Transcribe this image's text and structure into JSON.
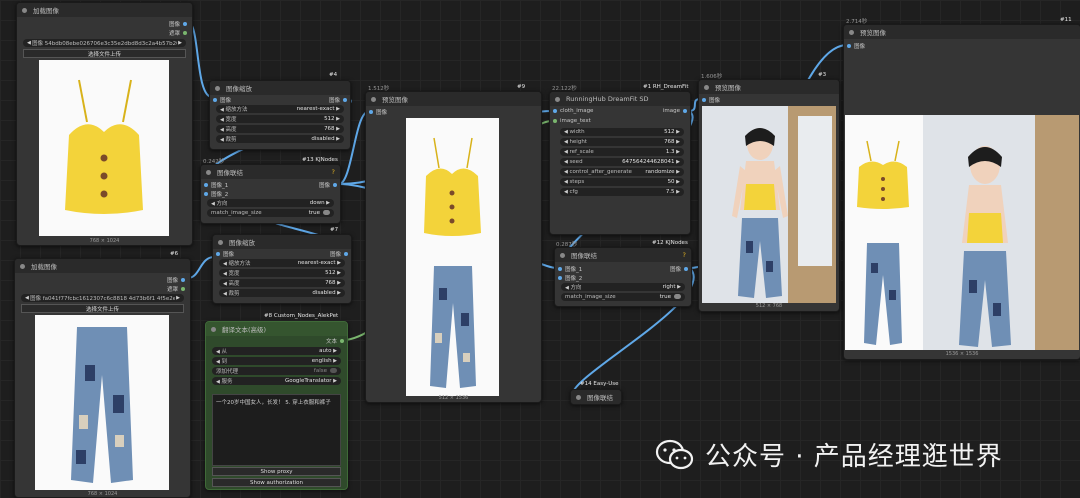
{
  "nodes": {
    "load1": {
      "title": "加载图像",
      "out_image": "图像",
      "out_mask": "遮罩",
      "file": "图像  54bdb08ebe026706e3c35e2dbd8d3c2a4b57b203...",
      "upload": "选择文件上传",
      "caption": "768 × 1024"
    },
    "load2": {
      "badge": "#6",
      "title": "加载图像",
      "out_image": "图像",
      "out_mask": "遮罩",
      "file": "图像  fa041f77fcbc1612307c6c8818 4d73b6f1 4f5e2ee881...",
      "upload": "选择文件上传",
      "caption": "768 × 1024"
    },
    "scale1": {
      "badge": "#4",
      "title": "图像缩放",
      "in_image": "图像",
      "out_image": "图像",
      "rows": [
        {
          "k": "缩放方法",
          "v": "nearest-exact"
        },
        {
          "k": "宽度",
          "v": "512"
        },
        {
          "k": "高度",
          "v": "768"
        },
        {
          "k": "裁剪",
          "v": "disabled"
        }
      ]
    },
    "scale2": {
      "badge": "#7",
      "title": "图像缩放",
      "in_image": "图像",
      "out_image": "图像",
      "rows": [
        {
          "k": "缩放方法",
          "v": "nearest-exact"
        },
        {
          "k": "宽度",
          "v": "512"
        },
        {
          "k": "高度",
          "v": "768"
        },
        {
          "k": "裁剪",
          "v": "disabled"
        }
      ]
    },
    "concat1": {
      "time": "0.242秒",
      "badge": "#13 KJNodes",
      "title": "图像联结",
      "in1": "图像_1",
      "in2": "图像_2",
      "out": "图像",
      "direction_k": "方向",
      "direction_v": "down",
      "match_k": "match_image_size",
      "match_v": "true"
    },
    "concat2": {
      "time": "0.287秒",
      "badge": "#12 KJNodes",
      "title": "图像联结",
      "in1": "图像_1",
      "in2": "图像_2",
      "out": "图像",
      "direction_k": "方向",
      "direction_v": "right",
      "match_k": "match_image_size",
      "match_v": "true"
    },
    "translate": {
      "badge": "#8 Custom_Nodes_AlekPet",
      "title": "翻译文本(高级)",
      "out": "文本",
      "rows": [
        {
          "k": "从",
          "v": "auto"
        },
        {
          "k": "到",
          "v": "english"
        },
        {
          "k": "添加代理",
          "v": "false"
        },
        {
          "k": "服务",
          "v": "GoogleTranslator"
        }
      ],
      "text": "一个20岁中国女人，长发！ 5. 穿上衣服和裤子",
      "show_proxy": "Show proxy",
      "show_auth": "Show authorization"
    },
    "preview1": {
      "time": "1.512秒",
      "badge": "#9",
      "title": "预览图像",
      "in": "图像",
      "caption": "512 × 1536"
    },
    "dreamfit": {
      "time": "22.122秒",
      "badge": "#1 RH_DreamFit",
      "title": "RunningHub DreamFit SD",
      "in1": "cloth_image",
      "in2": "image_text",
      "out": "image",
      "rows": [
        {
          "k": "width",
          "v": "512"
        },
        {
          "k": "height",
          "v": "768"
        },
        {
          "k": "ref_scale",
          "v": "1.3"
        },
        {
          "k": "seed",
          "v": "647564244628041"
        },
        {
          "k": "control_after_generate",
          "v": "randomize"
        },
        {
          "k": "steps",
          "v": "50"
        },
        {
          "k": "cfg",
          "v": "7.5"
        }
      ]
    },
    "preview2": {
      "time": "1.606秒",
      "badge": "#3",
      "title": "预览图像",
      "in": "图像",
      "caption": "512 × 768"
    },
    "preview3": {
      "time": "2.714秒",
      "badge": "#11",
      "title": "预览图像",
      "in": "图像",
      "caption": "1536 × 1536"
    },
    "easyuse": {
      "badge": "#14 Easy-Use",
      "title": "图像联结"
    }
  },
  "watermark": "公众号 · 产品经理逛世界",
  "colors": {
    "wire_image": "#5fa8e8",
    "wire_text": "#7ab66e",
    "node_bg": "#353535",
    "node_header": "#2a2a2a",
    "translate_bg": "#2f4a2b",
    "canvas": "#1e1e1e"
  }
}
